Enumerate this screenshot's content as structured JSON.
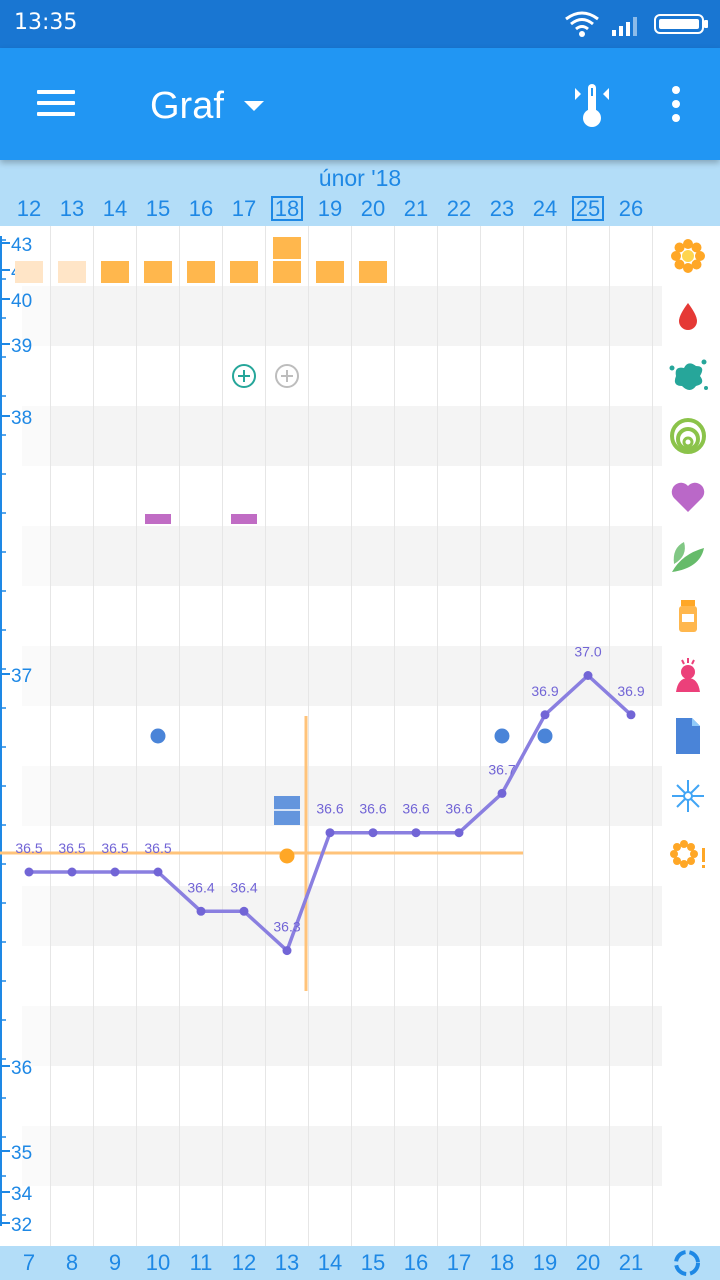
{
  "status_bar": {
    "time": "13:35"
  },
  "app_bar": {
    "title": "Graf"
  },
  "chart_data": {
    "type": "line",
    "month_label": "únor '18",
    "top_days": [
      "12",
      "13",
      "14",
      "15",
      "16",
      "17",
      "18",
      "19",
      "20",
      "21",
      "22",
      "23",
      "24",
      "25",
      "26"
    ],
    "highlighted_top_days": [
      "18",
      "25"
    ],
    "bottom_days": [
      "7",
      "8",
      "9",
      "10",
      "11",
      "12",
      "13",
      "14",
      "15",
      "16",
      "17",
      "18",
      "19",
      "20",
      "21"
    ],
    "y_ticks": [
      "43",
      "41",
      "40",
      "39",
      "38",
      "37",
      "36",
      "35",
      "34",
      "32"
    ],
    "series": [
      {
        "x": [
          "12",
          "13",
          "14",
          "15",
          "16",
          "17",
          "18",
          "19",
          "20",
          "21",
          "22",
          "23",
          "24",
          "25",
          "26"
        ],
        "y": [
          36.5,
          36.5,
          36.5,
          36.5,
          36.4,
          36.4,
          36.3,
          36.6,
          36.6,
          36.6,
          36.6,
          36.7,
          36.9,
          37.0,
          36.9
        ],
        "labels": [
          "36.5",
          "36.5",
          "36.5",
          "36.5",
          "36.4",
          "36.4",
          "36.3",
          "36.6",
          "36.6",
          "36.6",
          "36.6",
          "36.7",
          "36.9",
          "37.0",
          "36.9"
        ],
        "color": "#8A7FE0"
      }
    ],
    "coverline": 36.55,
    "ovulation_day": "18",
    "colors": {
      "line": "#8A7FE0",
      "point": "#7265D6",
      "period": "#FFB74D",
      "period_light": "#FFE5C7",
      "coverline": "#FFC37A",
      "mucus": "#4A84D8",
      "sex": "#C06CC4"
    }
  },
  "legend_icons": [
    "flower-icon",
    "drop-icon",
    "splash-icon",
    "rings-icon",
    "heart-icon",
    "leaf-icon",
    "pill-bottle-icon",
    "person-icon",
    "document-icon",
    "sparkle-icon",
    "flower-alert-icon"
  ]
}
